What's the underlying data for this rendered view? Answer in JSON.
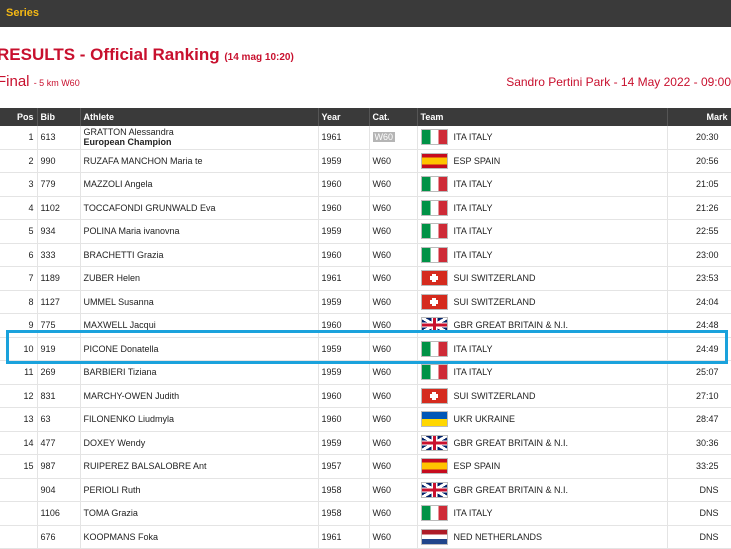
{
  "topbar": {
    "label": "Series"
  },
  "header": {
    "title": "RESULTS - Official Ranking",
    "timestamp": "(14 mag 10:20)",
    "final": "Final",
    "final_sub": "- 5 km W60",
    "venue": "Sandro Pertini Park - 14 May 2022 - 09:00"
  },
  "table": {
    "columns": {
      "pos": "Pos",
      "bib": "Bib",
      "athlete": "Athlete",
      "year": "Year",
      "cat": "Cat.",
      "team": "Team",
      "mark": "Mark"
    },
    "rows": [
      {
        "pos": "1",
        "bib": "613",
        "athlete": "GRATTON Alessandra",
        "sub": "European Champion",
        "year": "1961",
        "cat": "W60",
        "cat_badge": true,
        "flag": "ita",
        "team": "ITA ITALY",
        "mark": "20:30"
      },
      {
        "pos": "2",
        "bib": "990",
        "athlete": "RUZAFA MANCHON Maria te",
        "year": "1959",
        "cat": "W60",
        "flag": "esp",
        "team": "ESP SPAIN",
        "mark": "20:56"
      },
      {
        "pos": "3",
        "bib": "779",
        "athlete": "MAZZOLI Angela",
        "year": "1960",
        "cat": "W60",
        "flag": "ita",
        "team": "ITA ITALY",
        "mark": "21:05"
      },
      {
        "pos": "4",
        "bib": "1102",
        "athlete": "TOCCAFONDI GRUNWALD Eva",
        "year": "1960",
        "cat": "W60",
        "flag": "ita",
        "team": "ITA ITALY",
        "mark": "21:26"
      },
      {
        "pos": "5",
        "bib": "934",
        "athlete": "POLINA Maria ivanovna",
        "year": "1959",
        "cat": "W60",
        "flag": "ita",
        "team": "ITA ITALY",
        "mark": "22:55"
      },
      {
        "pos": "6",
        "bib": "333",
        "athlete": "BRACHETTI Grazia",
        "year": "1960",
        "cat": "W60",
        "flag": "ita",
        "team": "ITA ITALY",
        "mark": "23:00"
      },
      {
        "pos": "7",
        "bib": "1189",
        "athlete": "ZUBER Helen",
        "year": "1961",
        "cat": "W60",
        "flag": "sui",
        "team": "SUI SWITZERLAND",
        "mark": "23:53"
      },
      {
        "pos": "8",
        "bib": "1127",
        "athlete": "UMMEL Susanna",
        "year": "1959",
        "cat": "W60",
        "flag": "sui",
        "team": "SUI SWITZERLAND",
        "mark": "24:04"
      },
      {
        "pos": "9",
        "bib": "775",
        "athlete": "MAXWELL Jacqui",
        "year": "1960",
        "cat": "W60",
        "flag": "gbr",
        "team": "GBR GREAT BRITAIN & N.I.",
        "mark": "24:48"
      },
      {
        "pos": "10",
        "bib": "919",
        "athlete": "PICONE Donatella",
        "year": "1959",
        "cat": "W60",
        "flag": "ita",
        "team": "ITA ITALY",
        "mark": "24:49"
      },
      {
        "pos": "11",
        "bib": "269",
        "athlete": "BARBIERI Tiziana",
        "year": "1959",
        "cat": "W60",
        "flag": "ita",
        "team": "ITA ITALY",
        "mark": "25:07"
      },
      {
        "pos": "12",
        "bib": "831",
        "athlete": "MARCHY-OWEN Judith",
        "year": "1960",
        "cat": "W60",
        "flag": "sui",
        "team": "SUI SWITZERLAND",
        "mark": "27:10"
      },
      {
        "pos": "13",
        "bib": "63",
        "athlete": "FILONENKO Liudmyla",
        "year": "1960",
        "cat": "W60",
        "flag": "ukr",
        "team": "UKR UKRAINE",
        "mark": "28:47"
      },
      {
        "pos": "14",
        "bib": "477",
        "athlete": "DOXEY Wendy",
        "year": "1959",
        "cat": "W60",
        "flag": "gbr",
        "team": "GBR GREAT BRITAIN & N.I.",
        "mark": "30:36"
      },
      {
        "pos": "15",
        "bib": "987",
        "athlete": "RUIPEREZ BALSALOBRE Ant",
        "year": "1957",
        "cat": "W60",
        "flag": "esp",
        "team": "ESP SPAIN",
        "mark": "33:25"
      },
      {
        "pos": "",
        "bib": "904",
        "athlete": "PERIOLI Ruth",
        "year": "1958",
        "cat": "W60",
        "flag": "gbr",
        "team": "GBR GREAT BRITAIN & N.I.",
        "mark": "DNS"
      },
      {
        "pos": "",
        "bib": "1106",
        "athlete": "TOMA Grazia",
        "year": "1958",
        "cat": "W60",
        "flag": "ita",
        "team": "ITA ITALY",
        "mark": "DNS"
      },
      {
        "pos": "",
        "bib": "676",
        "athlete": "KOOPMANS Foka",
        "year": "1961",
        "cat": "W60",
        "flag": "ned",
        "team": "NED NETHERLANDS",
        "mark": "DNS"
      }
    ]
  },
  "highlighted_row": 10
}
